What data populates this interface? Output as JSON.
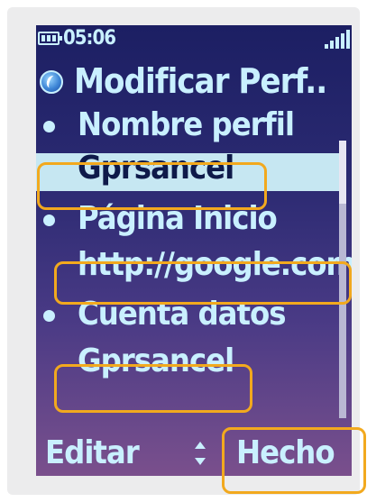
{
  "status_bar": {
    "time": "05:06",
    "battery_icon": "battery-icon",
    "signal_icon": "signal-strength-icon"
  },
  "header": {
    "title": "Modificar Perf..",
    "icon": "globe-icon"
  },
  "fields": [
    {
      "label": "Nombre perfil",
      "value": "Gprsancel",
      "selected": true
    },
    {
      "label": "Página Inicio",
      "value": "http://google.com"
    },
    {
      "label": "Cuenta datos",
      "value": "Gprsancel"
    }
  ],
  "softkeys": {
    "left": "Editar",
    "center_icon": "up-down-arrows-icon",
    "right": "Hecho"
  },
  "colors": {
    "text": "#c9f0ff",
    "selection_bg": "#c6e7f2",
    "highlight_border": "#f2a91e",
    "screen_top": "#1c1f63",
    "screen_bottom": "#7a4f8c"
  }
}
